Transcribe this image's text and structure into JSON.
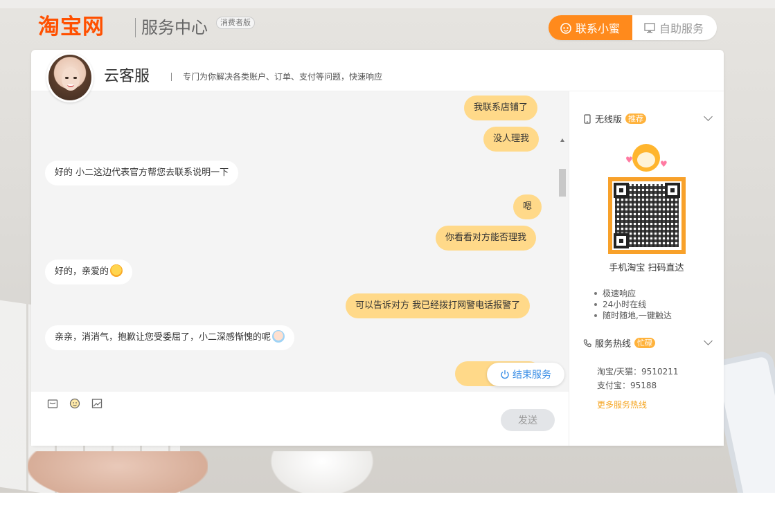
{
  "header": {
    "logo": "淘宝网",
    "service_title": "服务中心",
    "consumer_badge": "消费者版",
    "tabs": [
      {
        "label": "联系小蜜",
        "active": true
      },
      {
        "label": "自助服务",
        "active": false
      }
    ]
  },
  "agent": {
    "name": "云客服",
    "description": "专门为你解决各类账户、订单、支付等问题，快速响应"
  },
  "messages": [
    {
      "from": "user",
      "text": "我联系店铺了"
    },
    {
      "from": "user",
      "text": "没人理我"
    },
    {
      "from": "agent",
      "text": "好的 小二这边代表官方帮您去联系说明一下"
    },
    {
      "from": "user",
      "text": "嗯"
    },
    {
      "from": "user",
      "text": "你看看对方能否理我"
    },
    {
      "from": "agent",
      "text": "好的，亲爱的",
      "emoji": "love-emoji"
    },
    {
      "from": "user",
      "text": "可以告诉对方 我已经拨打网警电话报警了"
    },
    {
      "from": "agent",
      "text": "亲亲，消消气，抱歉让您受委屈了，小二深感惭愧的呢",
      "emoji": "baby-emoji"
    },
    {
      "from": "user",
      "text": "..."
    }
  ],
  "end_service_label": "结束服务",
  "send_label": "发送",
  "sidebar": {
    "mobile_title": "无线版",
    "mobile_badge": "推荐",
    "qr_caption": "手机淘宝 扫码直达",
    "features": [
      "极速响应",
      "24小时在线",
      "随时随地,一键触达"
    ],
    "hotline_title": "服务热线",
    "hotline_badge": "忙碌",
    "hotlines": [
      {
        "label": "淘宝/天猫：",
        "number": "9510211"
      },
      {
        "label": "支付宝：",
        "number": "95188"
      }
    ],
    "more_hotlines": "更多服务热线"
  },
  "colors": {
    "brand_orange": "#ff5000",
    "accent_tab": "#ff8a1c",
    "user_bubble": "#ffd989",
    "link_blue": "#3a8ee6",
    "badge": "#ffb23b"
  }
}
